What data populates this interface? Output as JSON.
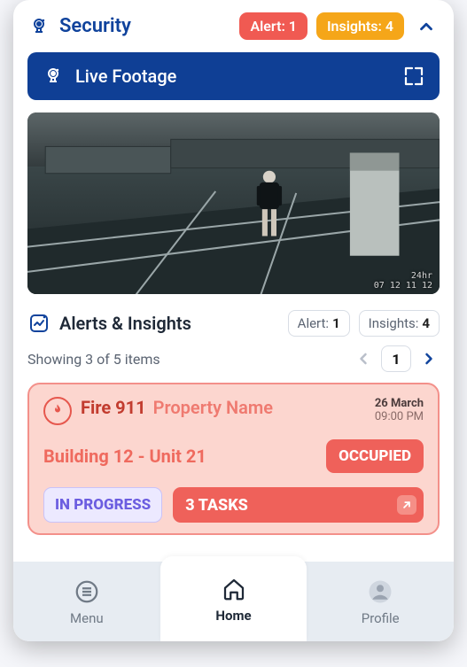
{
  "header": {
    "title": "Security",
    "alert_badge_label": "Alert:",
    "alert_badge_count": "1",
    "insights_badge_label": "Insights:",
    "insights_badge_count": "4"
  },
  "live_footage": {
    "title": "Live Footage",
    "timestamp_top": "24hr",
    "timestamp_bottom": "07 12 11 12"
  },
  "alerts_section": {
    "title": "Alerts & Insights",
    "alert_chip_label": "Alert:",
    "alert_chip_count": "1",
    "insights_chip_label": "Insights:",
    "insights_chip_count": "4",
    "showing_text": "Showing 3 of 5 items",
    "page_number": "1"
  },
  "alert_card": {
    "title": "Fire 911",
    "property_name": "Property Name",
    "date": "26 March",
    "time": "09:00 PM",
    "subtitle": "Building 12 - Unit 21",
    "occupied_label": "OCCUPIED",
    "status_label": "IN PROGRESS",
    "tasks_label": "3 TASKS"
  },
  "nav": {
    "menu": "Menu",
    "home": "Home",
    "profile": "Profile"
  }
}
